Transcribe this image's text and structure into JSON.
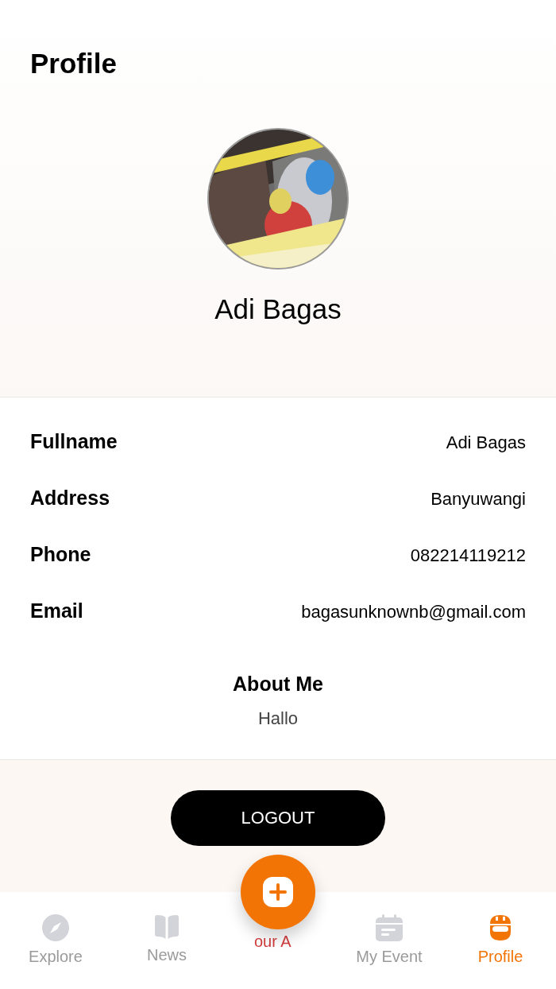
{
  "header": {
    "title": "Profile"
  },
  "profile": {
    "name": "Adi Bagas"
  },
  "fields": [
    {
      "label": "Fullname",
      "value": "Adi Bagas"
    },
    {
      "label": "Address",
      "value": "Banyuwangi"
    },
    {
      "label": "Phone",
      "value": "082214119212"
    },
    {
      "label": "Email",
      "value": "bagasunknownb@gmail.com"
    }
  ],
  "about": {
    "title": "About Me",
    "text": "Hallo"
  },
  "logout_button": "LOGOUT",
  "fab": {
    "hidden_label": "our A"
  },
  "nav": [
    {
      "label": "Explore",
      "selected": false
    },
    {
      "label": "News",
      "selected": false
    },
    {
      "label": "My Event",
      "selected": false
    },
    {
      "label": "Profile",
      "selected": true
    }
  ]
}
